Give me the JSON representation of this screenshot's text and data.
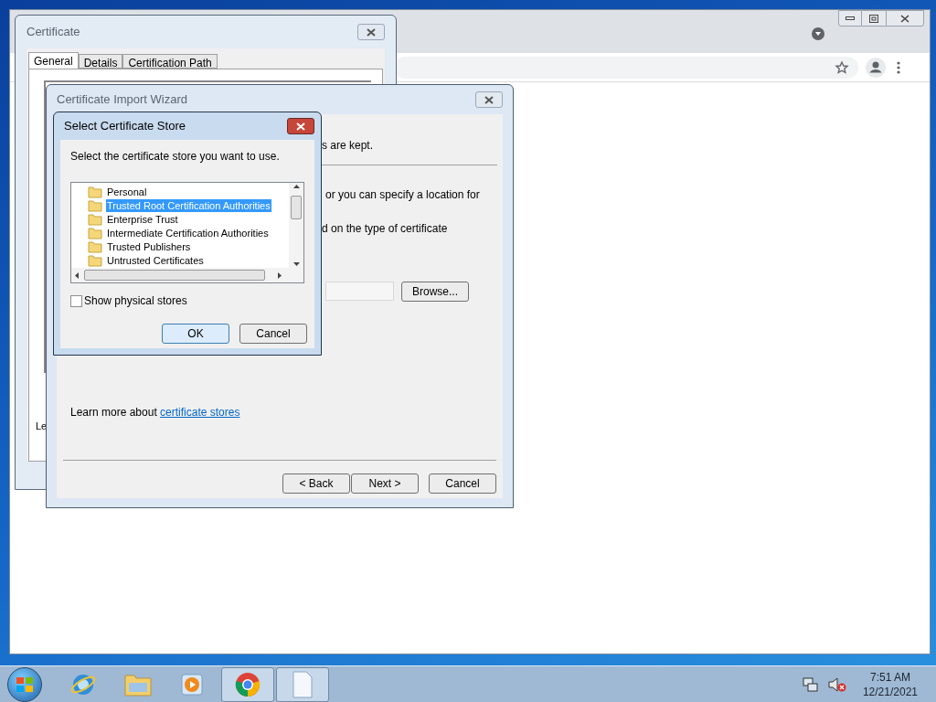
{
  "certificate_dialog": {
    "title": "Certificate",
    "tabs": [
      {
        "label": "General",
        "selected": true
      },
      {
        "label": "Details",
        "selected": false
      },
      {
        "label": "Certification Path",
        "selected": false
      }
    ],
    "partial_text": "Le"
  },
  "wizard": {
    "title": "Certificate Import Wizard",
    "fragments": [
      "s are kept.",
      "or you can specify a location for",
      "d on the type of certificate"
    ],
    "browse_button": "Browse...",
    "learn_more": {
      "text": "Learn more about",
      "link": "certificate stores"
    },
    "buttons": [
      {
        "label": "< Back"
      },
      {
        "label": "Next >"
      },
      {
        "label": "Cancel"
      }
    ]
  },
  "store_dialog": {
    "title": "Select Certificate Store",
    "prompt": "Select the certificate store you want to use.",
    "stores": [
      {
        "label": "Personal",
        "selected": false
      },
      {
        "label": "Trusted Root Certification Authorities",
        "selected": true
      },
      {
        "label": "Enterprise Trust",
        "selected": false
      },
      {
        "label": "Intermediate Certification Authorities",
        "selected": false
      },
      {
        "label": "Trusted Publishers",
        "selected": false
      },
      {
        "label": "Untrusted Certificates",
        "selected": false
      }
    ],
    "show_physical": {
      "label": "Show physical stores",
      "checked": false
    },
    "buttons": [
      {
        "label": "OK",
        "default": true
      },
      {
        "label": "Cancel",
        "default": false
      }
    ]
  },
  "taskbar": {
    "apps": [
      {
        "kind": "ie",
        "active": false
      },
      {
        "kind": "explorer",
        "active": false
      },
      {
        "kind": "media",
        "active": false
      },
      {
        "kind": "chrome",
        "active": true
      },
      {
        "kind": "document",
        "active": true
      }
    ],
    "time": "7:51 AM",
    "date": "12/21/2021"
  }
}
